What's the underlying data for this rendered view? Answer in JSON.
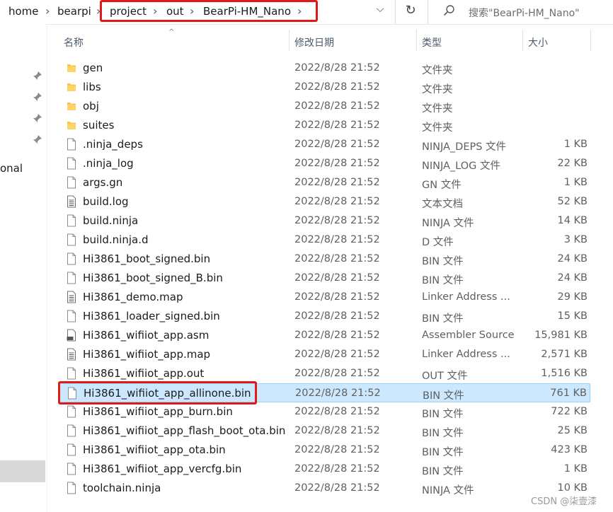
{
  "breadcrumb": {
    "items": [
      "home",
      "bearpi",
      "project",
      "out",
      "BearPi-HM_Nano"
    ]
  },
  "search": {
    "placeholder": "搜索\"BearPi-HM_Nano\""
  },
  "nav": {
    "partial_label": "onal"
  },
  "columns": {
    "name": "名称",
    "date": "修改日期",
    "type": "类型",
    "size": "大小"
  },
  "files": [
    {
      "name": "gen",
      "date": "2022/8/28 21:52",
      "type": "文件夹",
      "size": "",
      "kind": "folder"
    },
    {
      "name": "libs",
      "date": "2022/8/28 21:52",
      "type": "文件夹",
      "size": "",
      "kind": "folder"
    },
    {
      "name": "obj",
      "date": "2022/8/28 21:52",
      "type": "文件夹",
      "size": "",
      "kind": "folder"
    },
    {
      "name": "suites",
      "date": "2022/8/28 21:52",
      "type": "文件夹",
      "size": "",
      "kind": "folder"
    },
    {
      "name": ".ninja_deps",
      "date": "2022/8/28 21:52",
      "type": "NINJA_DEPS 文件",
      "size": "1 KB",
      "kind": "file"
    },
    {
      "name": ".ninja_log",
      "date": "2022/8/28 21:52",
      "type": "NINJA_LOG 文件",
      "size": "22 KB",
      "kind": "file"
    },
    {
      "name": "args.gn",
      "date": "2022/8/28 21:52",
      "type": "GN 文件",
      "size": "1 KB",
      "kind": "file"
    },
    {
      "name": "build.log",
      "date": "2022/8/28 21:52",
      "type": "文本文档",
      "size": "52 KB",
      "kind": "text"
    },
    {
      "name": "build.ninja",
      "date": "2022/8/28 21:52",
      "type": "NINJA 文件",
      "size": "14 KB",
      "kind": "file"
    },
    {
      "name": "build.ninja.d",
      "date": "2022/8/28 21:52",
      "type": "D 文件",
      "size": "3 KB",
      "kind": "file"
    },
    {
      "name": "Hi3861_boot_signed.bin",
      "date": "2022/8/28 21:52",
      "type": "BIN 文件",
      "size": "24 KB",
      "kind": "file"
    },
    {
      "name": "Hi3861_boot_signed_B.bin",
      "date": "2022/8/28 21:52",
      "type": "BIN 文件",
      "size": "24 KB",
      "kind": "file"
    },
    {
      "name": "Hi3861_demo.map",
      "date": "2022/8/28 21:52",
      "type": "Linker Address ...",
      "size": "29 KB",
      "kind": "text"
    },
    {
      "name": "Hi3861_loader_signed.bin",
      "date": "2022/8/28 21:52",
      "type": "BIN 文件",
      "size": "15 KB",
      "kind": "file"
    },
    {
      "name": "Hi3861_wifiiot_app.asm",
      "date": "2022/8/28 21:52",
      "type": "Assembler Source",
      "size": "15,981 KB",
      "kind": "asm"
    },
    {
      "name": "Hi3861_wifiiot_app.map",
      "date": "2022/8/28 21:52",
      "type": "Linker Address ...",
      "size": "2,571 KB",
      "kind": "text"
    },
    {
      "name": "Hi3861_wifiiot_app.out",
      "date": "2022/8/28 21:52",
      "type": "OUT 文件",
      "size": "1,516 KB",
      "kind": "file"
    },
    {
      "name": "Hi3861_wifiiot_app_allinone.bin",
      "date": "2022/8/28 21:52",
      "type": "BIN 文件",
      "size": "761 KB",
      "kind": "file",
      "selected": true
    },
    {
      "name": "Hi3861_wifiiot_app_burn.bin",
      "date": "2022/8/28 21:52",
      "type": "BIN 文件",
      "size": "722 KB",
      "kind": "file"
    },
    {
      "name": "Hi3861_wifiiot_app_flash_boot_ota.bin",
      "date": "2022/8/28 21:52",
      "type": "BIN 文件",
      "size": "25 KB",
      "kind": "file"
    },
    {
      "name": "Hi3861_wifiiot_app_ota.bin",
      "date": "2022/8/28 21:52",
      "type": "BIN 文件",
      "size": "423 KB",
      "kind": "file"
    },
    {
      "name": "Hi3861_wifiiot_app_vercfg.bin",
      "date": "2022/8/28 21:52",
      "type": "BIN 文件",
      "size": "1 KB",
      "kind": "file"
    },
    {
      "name": "toolchain.ninja",
      "date": "2022/8/28 21:52",
      "type": "NINJA 文件",
      "size": "10 KB",
      "kind": "file"
    }
  ],
  "watermark": "CSDN @柒壹漆",
  "colors": {
    "highlight_box": "#e01a1a",
    "selection_bg": "#cce8ff",
    "selection_border": "#99d1ff",
    "folder": "#f8c44a"
  },
  "icons": {
    "folder": "folder-icon",
    "file": "file-icon",
    "text": "text-document-icon",
    "asm": "asm-file-icon",
    "pin": "pin-icon",
    "search": "search-icon",
    "refresh": "refresh-icon"
  }
}
